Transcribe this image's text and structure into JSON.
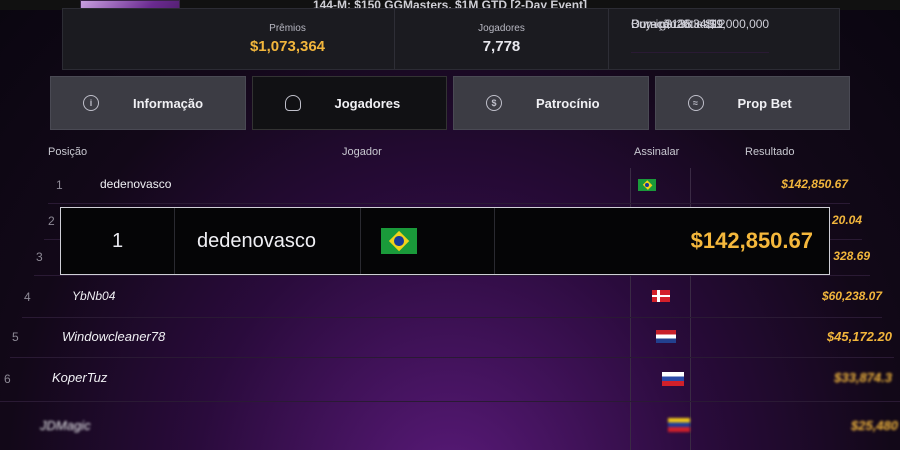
{
  "event_title": "144-M: $150 GGMasters, $1M GTD [2-Day Event]",
  "summary": {
    "prize_label": "Prêmios",
    "prize_value": "$1,073,364",
    "players_label": "Jogadores",
    "players_value": "7,778",
    "guarantee_label": "Com garantias",
    "guarantee_value": "$1,000,000",
    "buyin_label": "Buy-in",
    "buyin_value": "$138 + $12",
    "duration_label": "Duração",
    "duration_value": "26:34:19"
  },
  "tabs": [
    {
      "label": "Informação",
      "icon": "info-icon"
    },
    {
      "label": "Jogadores",
      "icon": "person-icon"
    },
    {
      "label": "Patrocínio",
      "icon": "coin-icon"
    },
    {
      "label": "Prop Bet",
      "icon": "handshake-icon"
    }
  ],
  "active_tab": "Jogadores",
  "columns": {
    "position": "Posição",
    "player": "Jogador",
    "sign": "Assinalar",
    "result": "Resultado"
  },
  "rows": [
    {
      "pos": "1",
      "name": "dedenovasco",
      "flag": "brazil-flag",
      "result": "$142,850.67"
    },
    {
      "pos": "2",
      "name": "",
      "flag": "",
      "result": "20.04"
    },
    {
      "pos": "3",
      "name": "",
      "flag": "",
      "result": "328.69"
    },
    {
      "pos": "4",
      "name": "YbNb04",
      "flag": "denmark-flag",
      "result": "$60,238.07"
    },
    {
      "pos": "5",
      "name": "Windowcleaner78",
      "flag": "netherlands-flag",
      "result": "$45,172.20"
    },
    {
      "pos": "6",
      "name": "KoperTuz",
      "flag": "russia-flag",
      "result": "$33,874.3"
    },
    {
      "pos": "",
      "name": "JDMagic",
      "flag": "venezuela-flag",
      "result": "$25,480"
    }
  ],
  "highlight": {
    "pos": "1",
    "name": "dedenovasco",
    "flag": "brazil-flag",
    "result": "$142,850.67"
  },
  "colors": {
    "gold": "#f2b63c",
    "background": "#2a0b3c"
  }
}
